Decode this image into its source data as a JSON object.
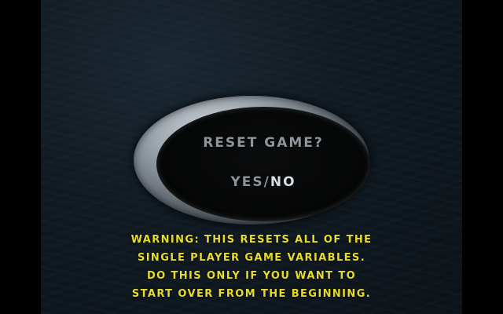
{
  "dialog": {
    "title": "RESET GAME?",
    "options": {
      "yes": "YES",
      "separator": "/",
      "no": "NO",
      "selected": "NO"
    }
  },
  "warning": {
    "lines": [
      "WARNING: THIS RESETS ALL OF THE",
      "SINGLE PLAYER GAME VARIABLES.",
      "DO THIS ONLY IF YOU WANT TO",
      "START OVER FROM THE BEGINNING."
    ]
  },
  "colors": {
    "warning_text": "#e8dc2a",
    "menu_text": "#8d959c",
    "selected_text": "#d7dde2",
    "background": "#0f171e"
  }
}
